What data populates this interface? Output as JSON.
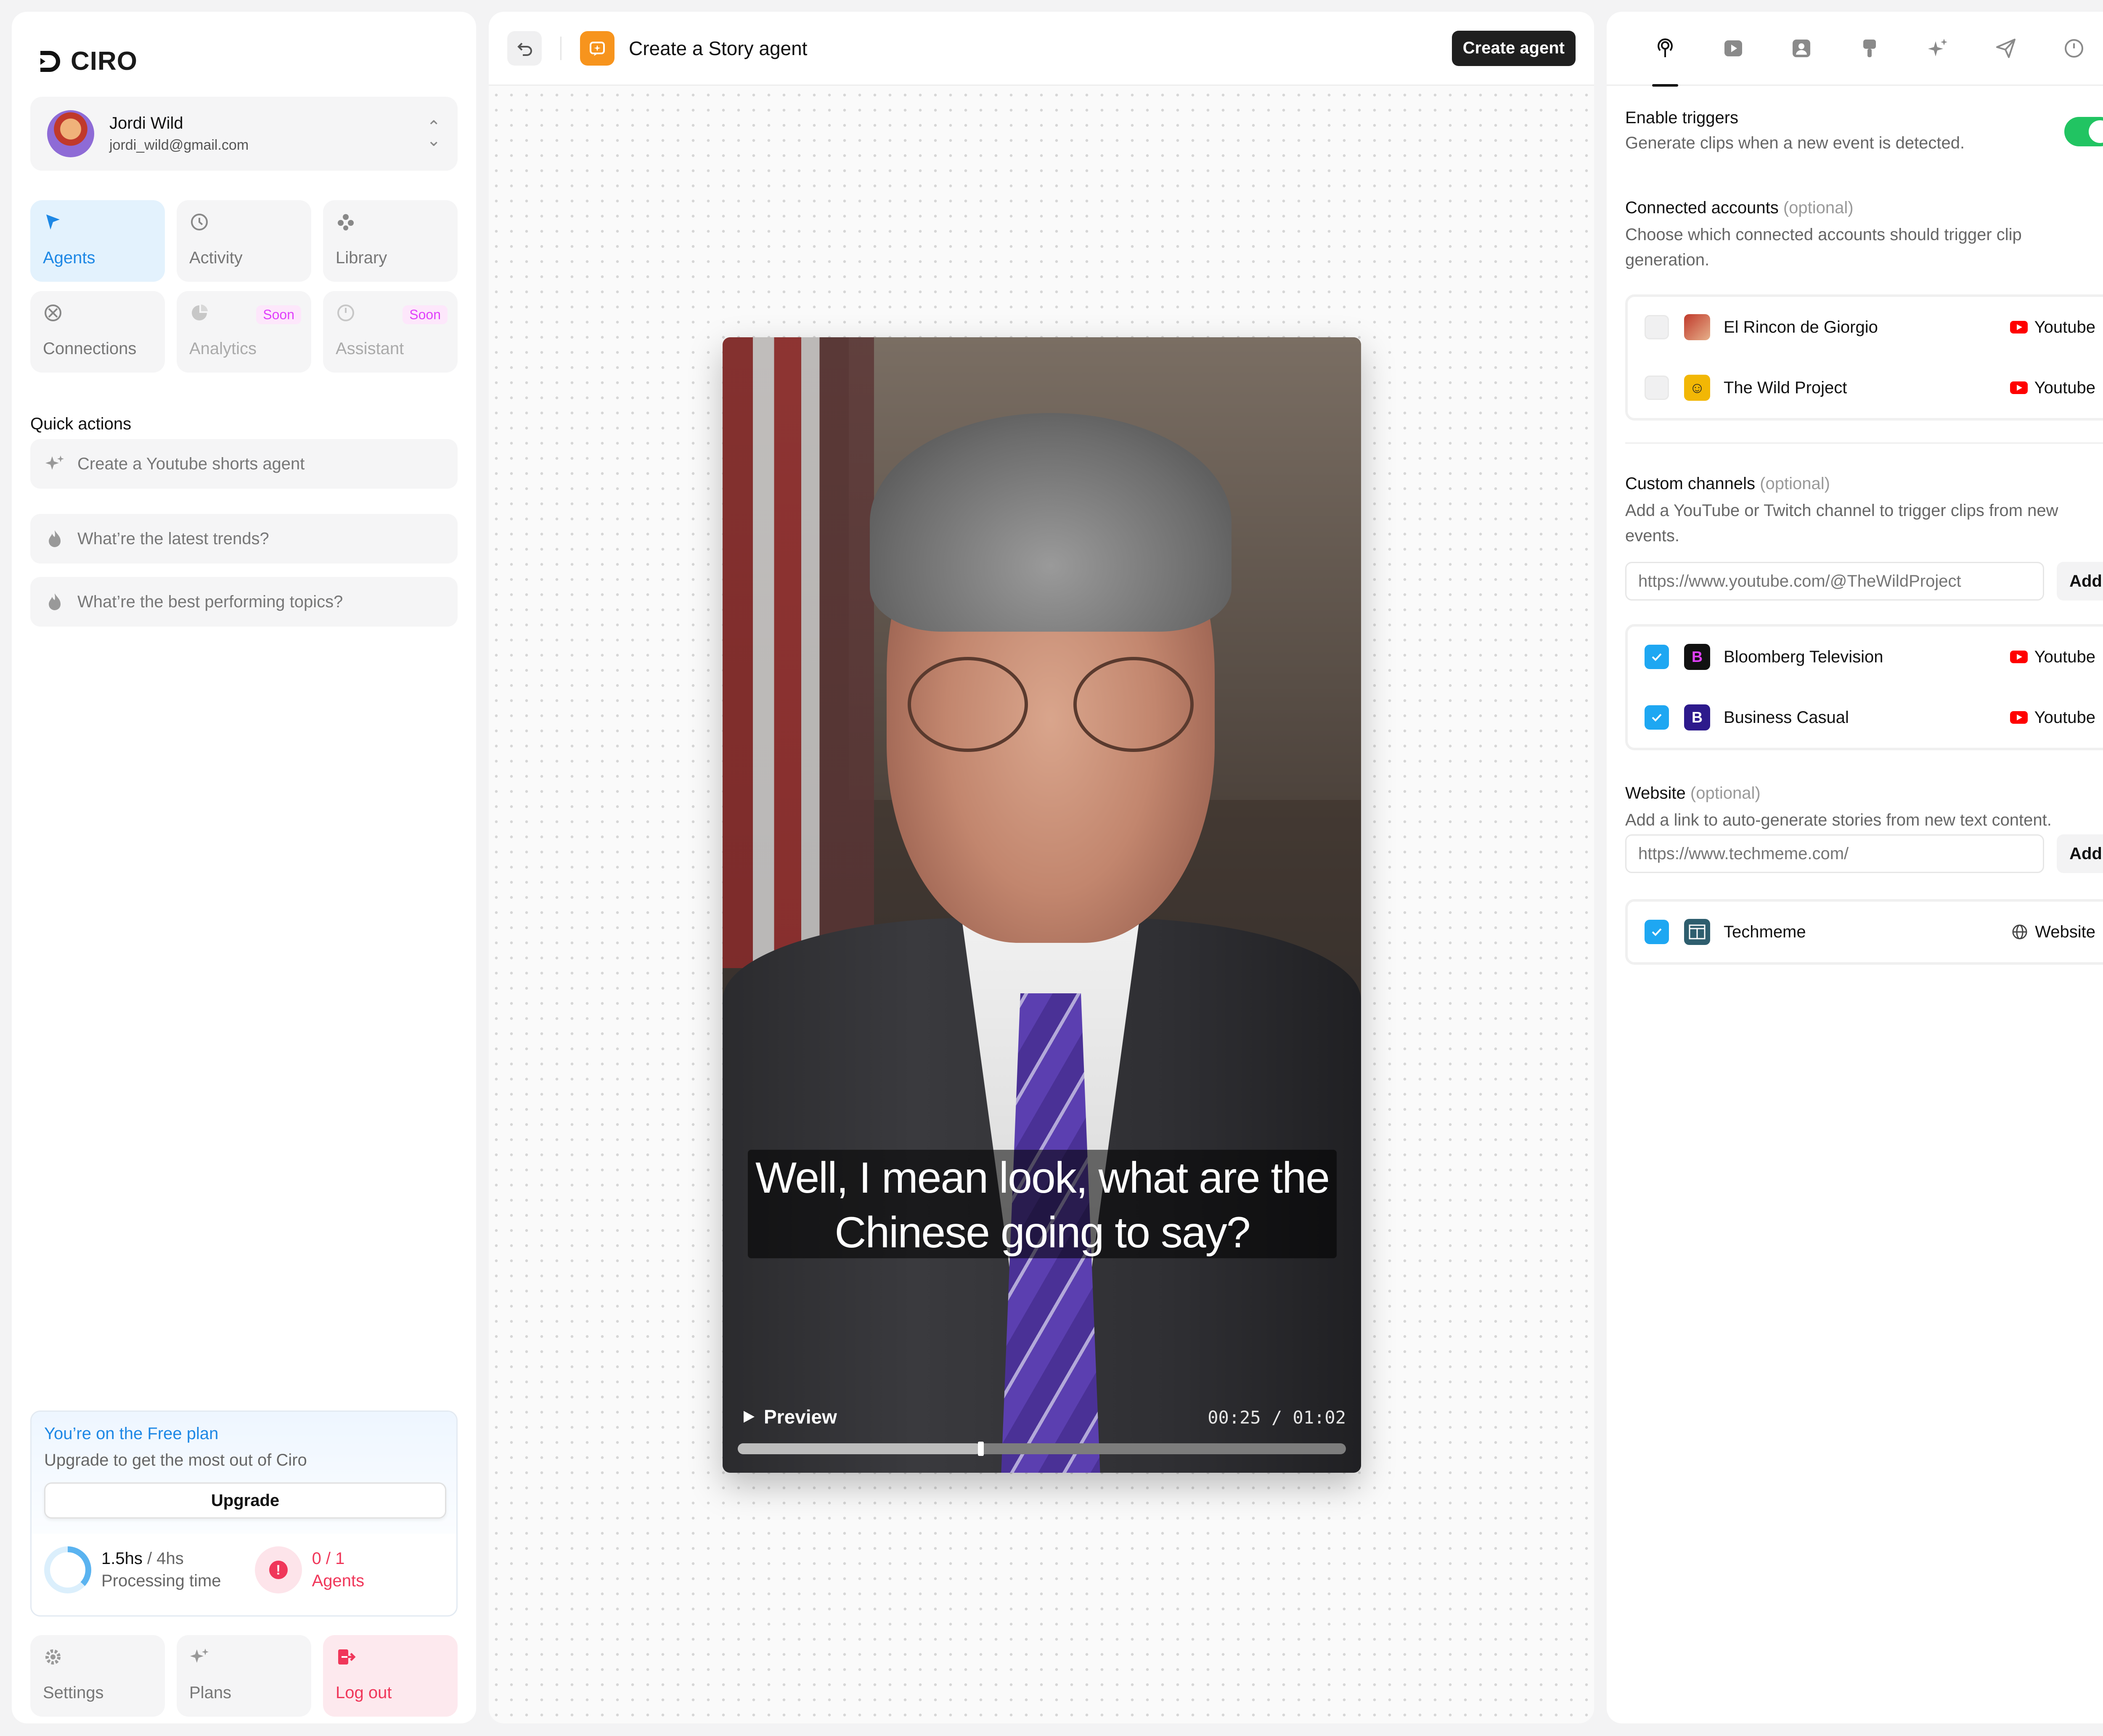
{
  "app": {
    "brand": "CIRO"
  },
  "user": {
    "name": "Jordi Wild",
    "email": "jordi_wild@gmail.com"
  },
  "nav": {
    "agents": "Agents",
    "activity": "Activity",
    "library": "Library",
    "connections": "Connections",
    "analytics": "Analytics",
    "assistant": "Assistant",
    "soon_badge": "Soon"
  },
  "quick_actions": {
    "title": "Quick actions",
    "items": [
      "Create a Youtube shorts agent",
      "What’re the latest trends?",
      "What’re the best performing topics?"
    ]
  },
  "plan": {
    "title": "You’re on the Free plan",
    "subtitle": "Upgrade to get the most out of Ciro",
    "upgrade_label": "Upgrade",
    "processing_used": "1.5hs",
    "processing_total": "/ 4hs",
    "processing_label": "Processing time",
    "processing_fraction": 0.375,
    "agents_count": "0 / 1",
    "agents_label": "Agents"
  },
  "footer_nav": {
    "settings": "Settings",
    "plans": "Plans",
    "logout": "Log out"
  },
  "editor": {
    "title": "Create a Story agent",
    "create_button": "Create agent"
  },
  "video": {
    "caption_line1": "Well, I mean look, what are the",
    "caption_line2": "Chinese going to say?",
    "preview_label": "Preview",
    "timecode": "00:25 / 01:02",
    "progress_fraction": 0.4
  },
  "right_panel": {
    "tabs": [
      "trigger-icon",
      "play-icon",
      "portrait-icon",
      "brush-icon",
      "sparkle-icon",
      "send-icon",
      "clock-icon"
    ],
    "triggers": {
      "title": "Enable triggers",
      "desc": "Generate clips when a new event is detected.",
      "enabled": true
    },
    "connected": {
      "title": "Connected accounts",
      "optional": "(optional)",
      "desc": "Choose which connected accounts should trigger clip generation.",
      "accounts": [
        {
          "name": "El Rincon de Giorgio",
          "source": "Youtube",
          "checked": false
        },
        {
          "name": "The Wild Project",
          "source": "Youtube",
          "checked": false
        }
      ]
    },
    "custom": {
      "title": "Custom channels",
      "optional": "(optional)",
      "desc": "Add a YouTube or Twitch channel to trigger clips from new events.",
      "placeholder": "https://www.youtube.com/@TheWildProject",
      "add_label": "Add",
      "channels": [
        {
          "name": "Bloomberg Television",
          "source": "Youtube",
          "checked": true
        },
        {
          "name": "Business Casual",
          "source": "Youtube",
          "checked": true
        }
      ]
    },
    "website": {
      "title": "Website",
      "optional": "(optional)",
      "desc": "Add a link to auto-generate stories from new text content.",
      "placeholder": "https://www.techmeme.com/",
      "add_label": "Add",
      "sites": [
        {
          "name": "Techmeme",
          "source": "Website",
          "checked": true
        }
      ]
    }
  },
  "colors": {
    "accent": "#1e88e5",
    "toggle_on": "#21c462",
    "checkbox_on": "#1ea7f2",
    "danger": "#f0375a",
    "agent_icon": "#f7941d"
  }
}
